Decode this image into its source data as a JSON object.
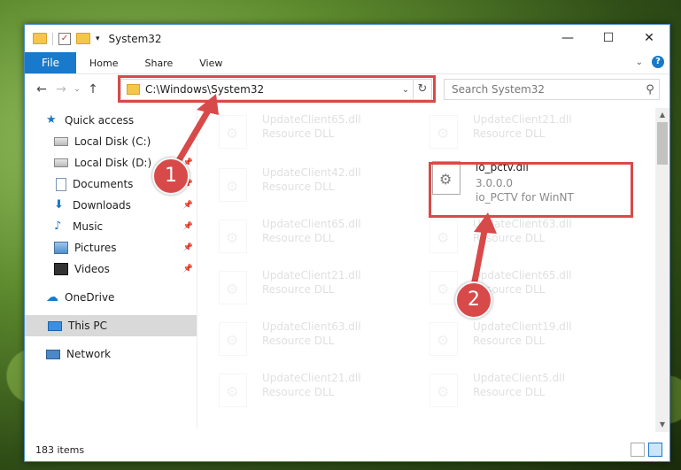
{
  "window": {
    "title": "System32",
    "controls": {
      "minimize": "—",
      "maximize": "☐",
      "close": "✕"
    }
  },
  "ribbon": {
    "tabs": [
      "File",
      "Home",
      "Share",
      "View"
    ],
    "help": "?"
  },
  "nav": {
    "address": "C:\\Windows\\System32",
    "search_placeholder": "Search System32"
  },
  "sidebar": {
    "items": [
      {
        "label": "Quick access",
        "icon": "star-icon"
      },
      {
        "label": "Local Disk (C:)",
        "icon": "drive-icon"
      },
      {
        "label": "Local Disk (D:)",
        "icon": "drive-icon"
      },
      {
        "label": "Documents",
        "icon": "documents-icon"
      },
      {
        "label": "Downloads",
        "icon": "download-icon"
      },
      {
        "label": "Music",
        "icon": "music-icon"
      },
      {
        "label": "Pictures",
        "icon": "pictures-icon"
      },
      {
        "label": "Videos",
        "icon": "videos-icon"
      },
      {
        "label": "OneDrive",
        "icon": "cloud-icon"
      },
      {
        "label": "This PC",
        "icon": "computer-icon"
      },
      {
        "label": "Network",
        "icon": "network-icon"
      }
    ]
  },
  "files": [
    {
      "name": "UpdateClient65.dll",
      "desc": "Resource DLL"
    },
    {
      "name": "UpdateClient21.dll",
      "desc": "Resource DLL"
    },
    {
      "name": "UpdateClient42.dll",
      "desc": "Resource DLL"
    },
    {
      "name": "io_pctv.dll",
      "desc": "3.0.0.0",
      "desc2": "io_PCTV for WinNT"
    },
    {
      "name": "UpdateClient65.dll",
      "desc": "Resource DLL"
    },
    {
      "name": "UpdateClient63.dll",
      "desc": "Resource DLL"
    },
    {
      "name": "UpdateClient21.dll",
      "desc": "Resource DLL"
    },
    {
      "name": "UpdateClient65.dll",
      "desc": "Resource DLL"
    },
    {
      "name": "UpdateClient63.dll",
      "desc": "Resource DLL"
    },
    {
      "name": "UpdateClient19.dll",
      "desc": "Resource DLL"
    },
    {
      "name": "UpdateClient21.dll",
      "desc": "Resource DLL"
    },
    {
      "name": "UpdateClient5.dll",
      "desc": "Resource DLL"
    }
  ],
  "status": {
    "count": "183 items"
  },
  "callouts": {
    "one": "1",
    "two": "2"
  },
  "colors": {
    "accent": "#1979ca",
    "callout": "#d84a4a"
  }
}
